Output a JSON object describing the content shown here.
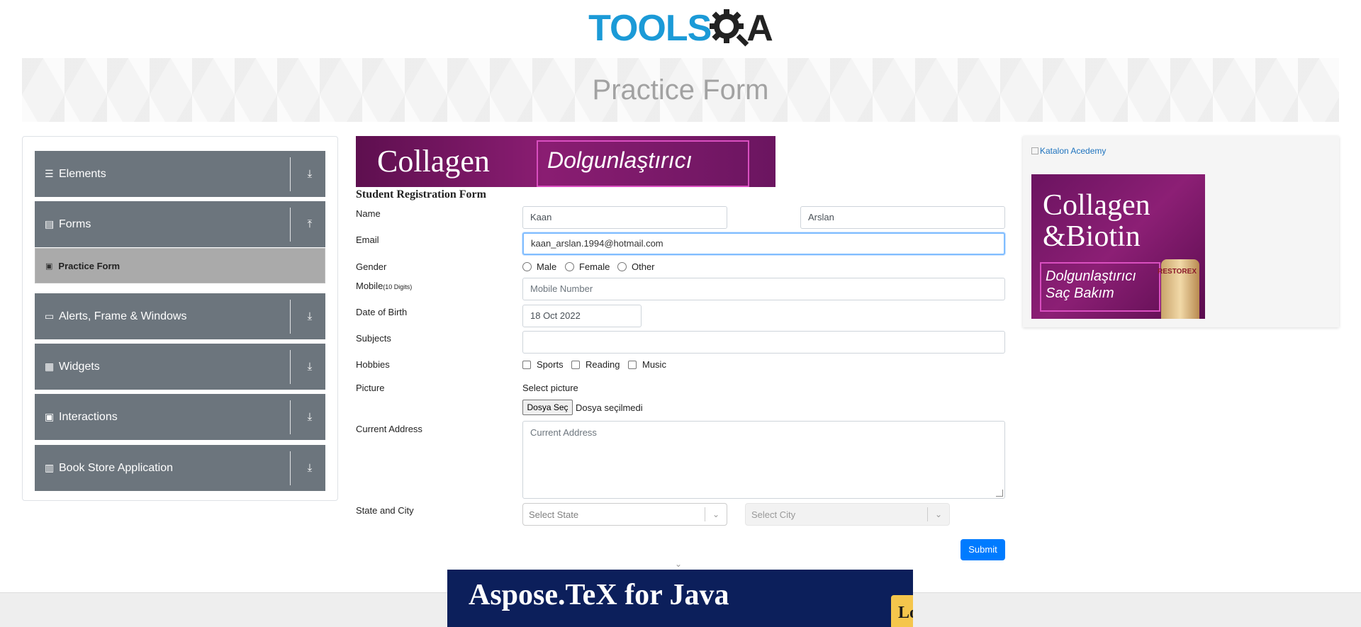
{
  "header": {
    "logo_part1": "TOOLS",
    "logo_part2": "A"
  },
  "page_title": "Practice Form",
  "sidebar": {
    "groups": [
      {
        "label": "Elements",
        "icon": "hamburger-icon"
      },
      {
        "label": "Forms",
        "icon": "form-icon",
        "expanded": true
      },
      {
        "label": "Alerts, Frame & Windows",
        "icon": "window-icon"
      },
      {
        "label": "Widgets",
        "icon": "widgets-icon"
      },
      {
        "label": "Interactions",
        "icon": "interactions-icon"
      },
      {
        "label": "Book Store Application",
        "icon": "book-icon"
      }
    ],
    "active_item": "Practice Form"
  },
  "ad_top": {
    "line1": "Collagen",
    "line2": "Dolgunlaştırıcı"
  },
  "form": {
    "title": "Student Registration Form",
    "labels": {
      "name": "Name",
      "email": "Email",
      "gender": "Gender",
      "mobile": "Mobile",
      "mobile_hint": "(10 Digits)",
      "dob": "Date of Birth",
      "subjects": "Subjects",
      "hobbies": "Hobbies",
      "picture": "Picture",
      "address": "Current Address",
      "state_city": "State and City"
    },
    "first_name": "Kaan",
    "last_name": "Arslan",
    "email": "kaan_arslan.1994@hotmail.com",
    "gender_options": [
      "Male",
      "Female",
      "Other"
    ],
    "mobile_placeholder": "Mobile Number",
    "dob": "18 Oct 2022",
    "subjects": "",
    "hobbies": [
      "Sports",
      "Reading",
      "Music"
    ],
    "picture_label": "Select picture",
    "file_button": "Dosya Seç",
    "file_status": "Dosya seçilmedi",
    "address_placeholder": "Current Address",
    "state_placeholder": "Select State",
    "city_placeholder": "Select City",
    "submit": "Submit"
  },
  "right_ad": {
    "alt_text": "Katalon Acedemy",
    "line1": "Collagen",
    "line2": "&Biotin",
    "line3": "Dolgunlaştırıcı",
    "line4": "Saç Bakım",
    "brand": "RESTOREX"
  },
  "bottom_ad": {
    "title": "Aspose.TeX for Java",
    "button_partial": "Lo"
  },
  "colors": {
    "sidebar_group": "#6c757d",
    "active_item": "#aaaaaa",
    "submit": "#007bff",
    "logo_blue": "#1b9ad7"
  }
}
